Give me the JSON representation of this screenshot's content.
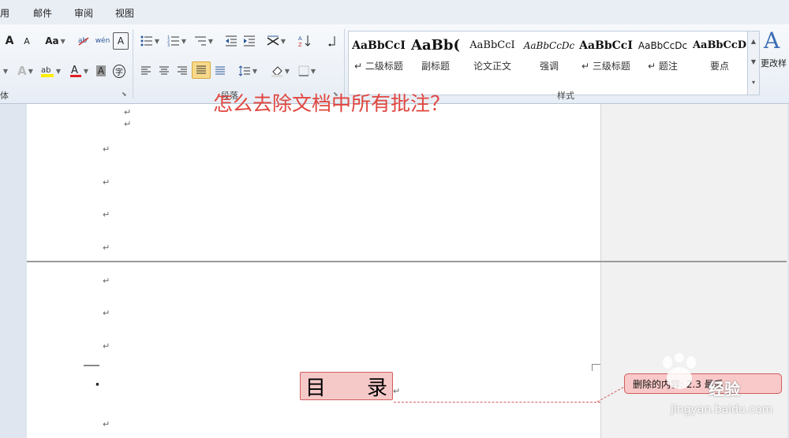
{
  "menu": [
    "用",
    "邮件",
    "审阅",
    "视图"
  ],
  "ribbon": {
    "groups": {
      "font": "体",
      "paragraph": "段落",
      "styles": "样式"
    },
    "font_buttons": [
      "A",
      "A",
      "Aa",
      "wén",
      "A",
      "A",
      "A",
      "A",
      "字"
    ],
    "styles": [
      {
        "sample": "AaBbCcI",
        "name": "二级标题"
      },
      {
        "sample": "AaBb(",
        "name": "副标题"
      },
      {
        "sample": "AaBbCcI",
        "name": "论文正文"
      },
      {
        "sample": "AaBbCcDc",
        "name": "强调"
      },
      {
        "sample": "AaBbCcI",
        "name": "三级标题"
      },
      {
        "sample": "AaBbCcDc",
        "name": "题注"
      },
      {
        "sample": "AaBbCcD",
        "name": "要点"
      }
    ],
    "change_style": "更改样"
  },
  "document": {
    "question": "怎么去除文档中所有批注？",
    "toc_heading": {
      "left": "目",
      "right": "录"
    },
    "paragraph_mark": "↵",
    "bullet": "·"
  },
  "comment": {
    "text": "删除的内容: 2.3 最后"
  },
  "watermark": {
    "site": "jingyan.baidu.com",
    "brand": "经验"
  },
  "colors": {
    "accent_red": "#e0463f",
    "comment_fill": "#f9c8c8",
    "active_button": "#f7d98b"
  }
}
